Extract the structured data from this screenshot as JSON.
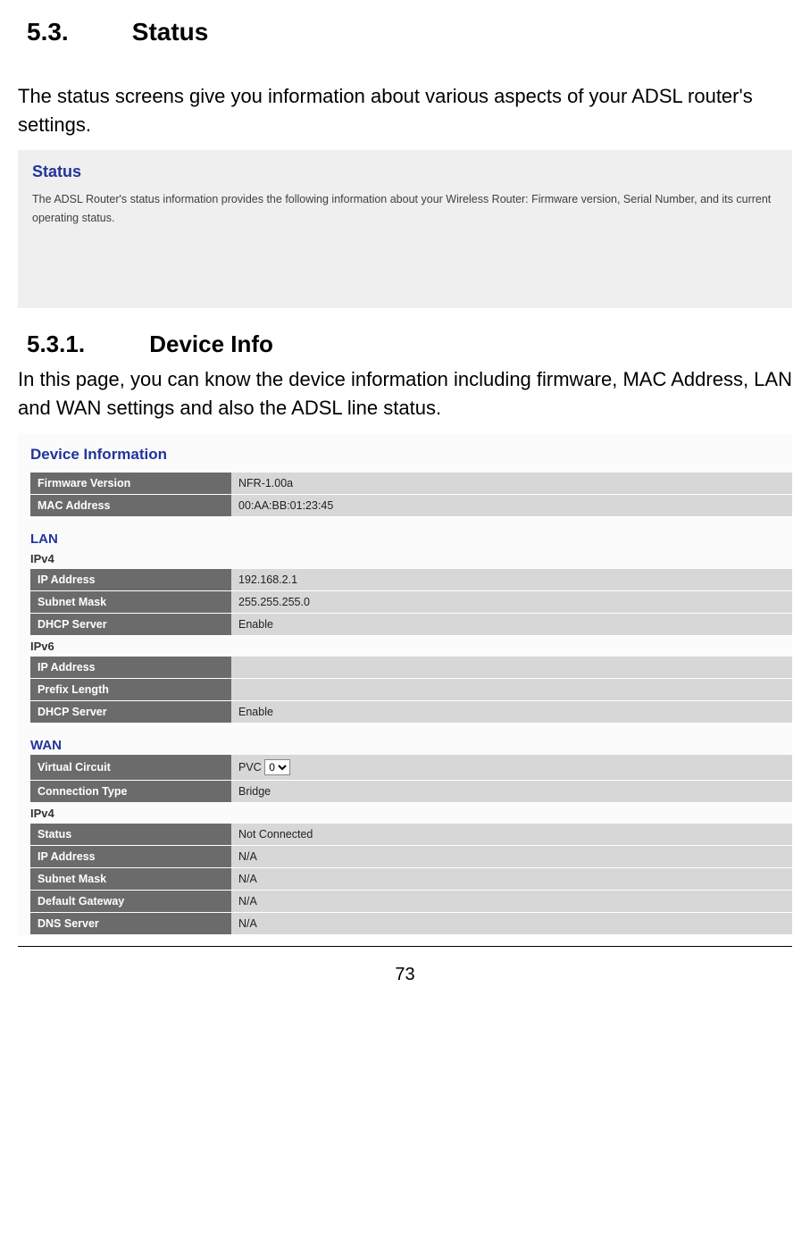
{
  "doc": {
    "section_num": "5.3.",
    "section_title": "Status",
    "section_body": "The status screens give you information about various aspects of your ADSL router's settings.",
    "subsection_num": "5.3.1.",
    "subsection_title": "Device Info",
    "subsection_body": "In this page, you can know the device information including firmware, MAC Address, LAN and WAN settings and also the ADSL line status.",
    "page_number": "73"
  },
  "panel1": {
    "title": "Status",
    "desc": "The ADSL Router's status information provides the following information about your Wireless Router: Firmware version, Serial Number, and its current operating status."
  },
  "devinfo": {
    "title": "Device Information",
    "top_rows": [
      {
        "label": "Firmware Version",
        "value": "NFR-1.00a"
      },
      {
        "label": "MAC Address",
        "value": "00:AA:BB:01:23:45"
      }
    ],
    "lan_title": "LAN",
    "lan_ipv4_title": "IPv4",
    "lan_ipv4_rows": [
      {
        "label": "IP Address",
        "value": "192.168.2.1"
      },
      {
        "label": "Subnet Mask",
        "value": "255.255.255.0"
      },
      {
        "label": "DHCP Server",
        "value": "Enable"
      }
    ],
    "lan_ipv6_title": "IPv6",
    "lan_ipv6_rows": [
      {
        "label": "IP Address",
        "value": ""
      },
      {
        "label": "Prefix Length",
        "value": ""
      },
      {
        "label": "DHCP Server",
        "value": "Enable"
      }
    ],
    "wan_title": "WAN",
    "wan_top": {
      "vc_label": "Virtual Circuit",
      "vc_prefix": "PVC",
      "vc_selected": "0",
      "ct_label": "Connection Type",
      "ct_value": "Bridge"
    },
    "wan_ipv4_title": "IPv4",
    "wan_ipv4_rows": [
      {
        "label": "Status",
        "value": "Not Connected"
      },
      {
        "label": "IP Address",
        "value": "N/A"
      },
      {
        "label": "Subnet Mask",
        "value": "N/A"
      },
      {
        "label": "Default Gateway",
        "value": "N/A"
      },
      {
        "label": "DNS Server",
        "value": "N/A"
      }
    ]
  }
}
